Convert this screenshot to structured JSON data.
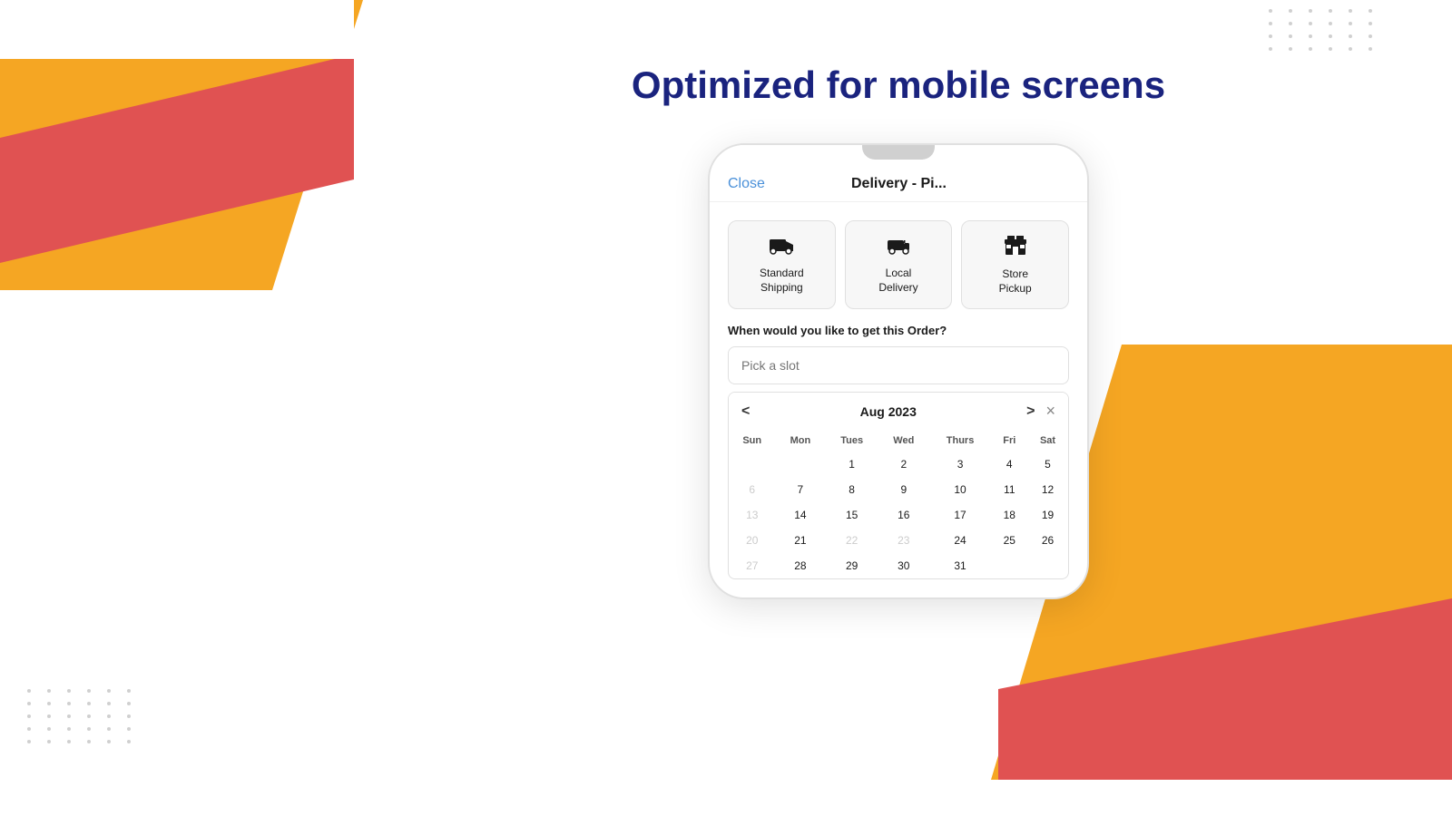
{
  "page": {
    "title": "Optimized for mobile screens",
    "background_color": "#ffffff"
  },
  "phone": {
    "header": {
      "close_label": "Close",
      "title": "Delivery - Pi..."
    },
    "delivery_options": [
      {
        "id": "standard",
        "label": "Standard Shipping",
        "icon": "🚚",
        "active": false
      },
      {
        "id": "local",
        "label": "Local Delivery",
        "icon": "🛵",
        "active": false
      },
      {
        "id": "store",
        "label": "Store Pickup",
        "icon": "🏪",
        "active": false
      }
    ],
    "slot_section": {
      "label": "When would you like to get this Order?",
      "placeholder": "Pick a slot"
    },
    "calendar": {
      "month": "Aug 2023",
      "prev_label": "<",
      "next_label": ">",
      "close_label": "×",
      "days_of_week": [
        "Sun",
        "Mon",
        "Tues",
        "Wed",
        "Thurs",
        "Fri",
        "Sat"
      ],
      "weeks": [
        [
          "",
          "",
          "1",
          "2",
          "3",
          "4",
          "5"
        ],
        [
          "6",
          "7",
          "8",
          "9",
          "10",
          "11",
          "12"
        ],
        [
          "13",
          "14",
          "15",
          "16",
          "17",
          "18",
          "19"
        ],
        [
          "20",
          "21",
          "22",
          "23",
          "24",
          "25",
          "26"
        ],
        [
          "27",
          "28",
          "29",
          "30",
          "31",
          "",
          ""
        ]
      ],
      "disabled_days": [
        "6",
        "13",
        "20",
        "22",
        "23",
        "27"
      ]
    }
  },
  "decorations": {
    "dots_count": 24
  }
}
